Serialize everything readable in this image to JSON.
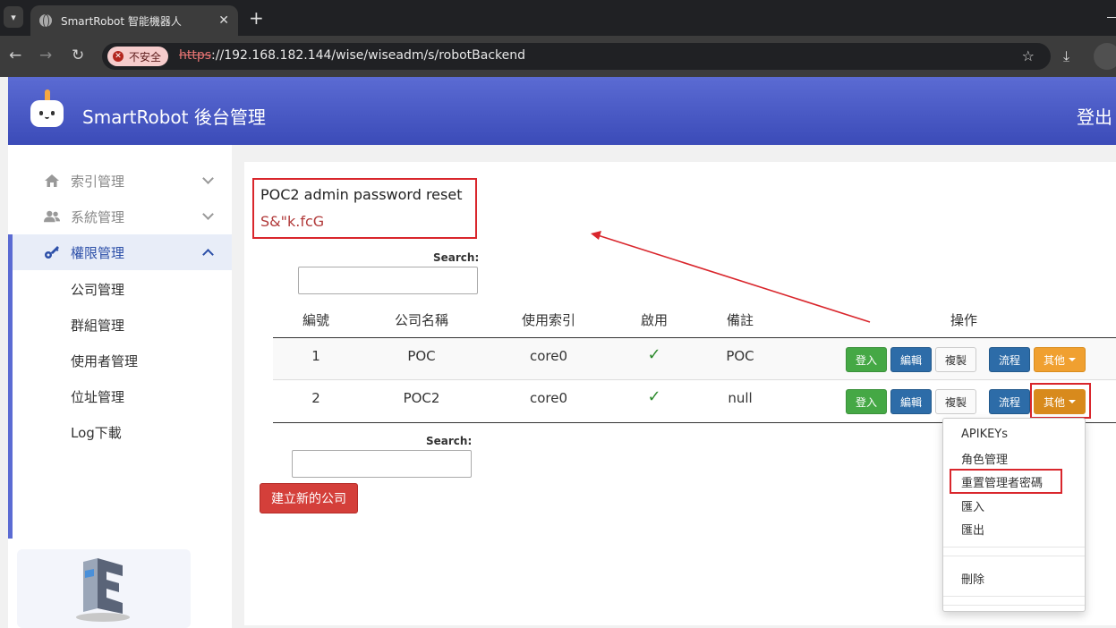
{
  "browser": {
    "tab_title": "SmartRobot 智能機器人",
    "security_label": "不安全",
    "url_scheme": "https",
    "url_rest": "://192.168.182.144/wise/wiseadm/s/robotBackend"
  },
  "header": {
    "title": "SmartRobot 後台管理",
    "logout": "登出"
  },
  "sidebar": {
    "items": [
      {
        "label": "索引管理",
        "icon": "home-icon"
      },
      {
        "label": "系統管理",
        "icon": "users-icon"
      },
      {
        "label": "權限管理",
        "icon": "key-icon"
      }
    ],
    "sub_items": [
      "公司管理",
      "群組管理",
      "使用者管理",
      "位址管理",
      "Log下載"
    ]
  },
  "notice": {
    "title": "POC2 admin password reset",
    "password": "S&\"k.fcG"
  },
  "search": {
    "top_label": "Search:",
    "bottom_label": "Search:"
  },
  "table": {
    "headers": [
      "編號",
      "公司名稱",
      "使用索引",
      "啟用",
      "備註",
      "操作"
    ],
    "rows": [
      {
        "id": "1",
        "name": "POC",
        "index": "core0",
        "enabled": "✓",
        "note": "POC"
      },
      {
        "id": "2",
        "name": "POC2",
        "index": "core0",
        "enabled": "✓",
        "note": "null"
      }
    ],
    "actions": {
      "login": "登入",
      "edit": "編輯",
      "copy": "複製",
      "flow": "流程",
      "other": "其他"
    }
  },
  "dropdown": {
    "items": [
      "APIKEYs",
      "角色管理",
      "重置管理者密碼",
      "匯入",
      "匯出"
    ],
    "delete": "刪除"
  },
  "new_company_button": "建立新的公司",
  "colors": {
    "header_gradient_top": "#5b6bd3",
    "header_gradient_bottom": "#3b4bb8",
    "highlight_red": "#d9262c",
    "btn_green": "#45a845",
    "btn_blue": "#2d6ca8",
    "btn_orange": "#f0a030",
    "btn_danger": "#d43f3a"
  }
}
